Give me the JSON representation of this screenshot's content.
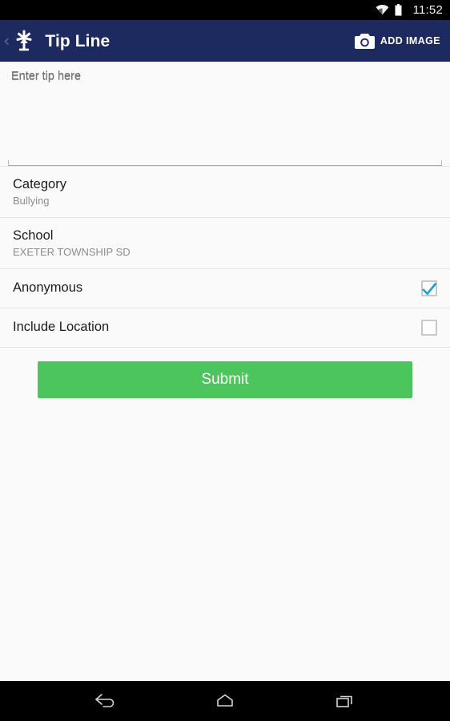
{
  "status_bar": {
    "time": "11:52",
    "icons": [
      "wifi-icon",
      "battery-icon"
    ],
    "background_color": "#000000"
  },
  "app_bar": {
    "back_label": "‹",
    "logo_icon": "snowflake-logo-icon",
    "title": "Tip Line",
    "background_color": "#1c2a60",
    "action": {
      "icon": "camera-icon",
      "label": "ADD IMAGE"
    }
  },
  "tip_field": {
    "placeholder": "Enter tip here",
    "value": ""
  },
  "rows": [
    {
      "name": "category",
      "label": "Category",
      "value": "Bullying",
      "type": "select"
    },
    {
      "name": "school",
      "label": "School",
      "value": "EXETER TOWNSHIP SD",
      "type": "select"
    },
    {
      "name": "anonymous",
      "label": "Anonymous",
      "type": "checkbox",
      "checked": true
    },
    {
      "name": "include-location",
      "label": "Include Location",
      "type": "checkbox",
      "checked": false
    }
  ],
  "submit": {
    "label": "Submit",
    "color": "#4CC65C"
  },
  "nav_bar": {
    "buttons": [
      "back-nav-icon",
      "home-nav-icon",
      "recents-nav-icon"
    ],
    "background_color": "#000000"
  },
  "colors": {
    "accent_checkbox": "#1f9fd4",
    "page_background": "#fafafa",
    "divider": "#e4e4e4",
    "primary_text": "#1c1c1c",
    "secondary_text": "#8d8d8d"
  }
}
